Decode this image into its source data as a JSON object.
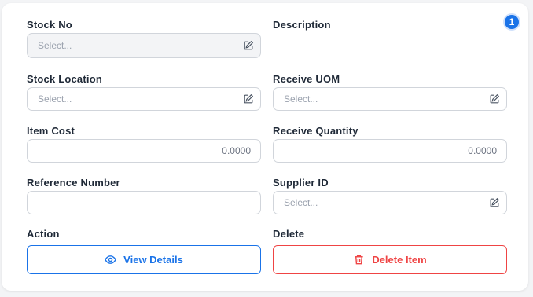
{
  "badge": "1",
  "fields": {
    "stock_no": {
      "label": "Stock No",
      "placeholder": "Select..."
    },
    "description": {
      "label": "Description"
    },
    "stock_location": {
      "label": "Stock Location",
      "placeholder": "Select..."
    },
    "receive_uom": {
      "label": "Receive UOM",
      "placeholder": "Select..."
    },
    "item_cost": {
      "label": "Item Cost",
      "value": "0.0000"
    },
    "receive_quantity": {
      "label": "Receive Quantity",
      "value": "0.0000"
    },
    "reference_number": {
      "label": "Reference Number",
      "value": ""
    },
    "supplier_id": {
      "label": "Supplier ID",
      "placeholder": "Select..."
    }
  },
  "action": {
    "label": "Action",
    "button": "View Details",
    "icon": "eye-icon"
  },
  "delete": {
    "label": "Delete",
    "button": "Delete Item",
    "icon": "trash-icon"
  },
  "colors": {
    "accent": "#1a73e8",
    "danger": "#ef4444"
  }
}
